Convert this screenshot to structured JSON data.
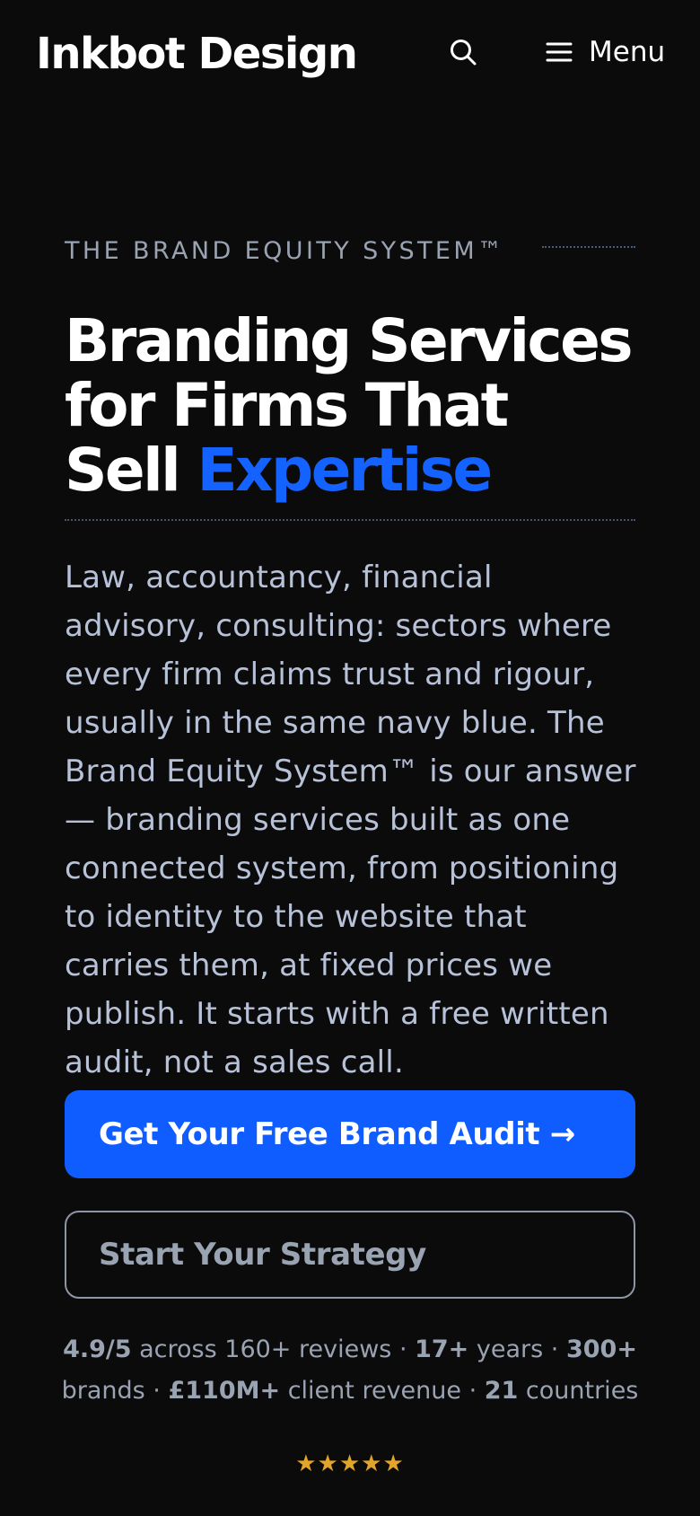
{
  "header": {
    "logo_text": "Inkbot Design",
    "search_icon": "search-icon",
    "menu_icon": "hamburger-icon",
    "menu_label": "Menu"
  },
  "hero": {
    "eyebrow": "THE BRAND EQUITY SYSTEM™",
    "headline_lines": [
      "Branding Services",
      "for Firms That",
      "Sell "
    ],
    "headline_accent": "Expertise",
    "intro": "Law, accountancy, financial advisory, consulting: sectors where every firm claims trust and rigour, usually in the same navy blue. The Brand Equity System™ is our answer — branding services built as one connected system, from positioning to identity to the website that carries them, at fixed prices we publish. It starts with a free written audit, not a sales call."
  },
  "cta": {
    "primary_label": "Get Your Free Brand Audit →",
    "secondary_label": "Start Your Strategy"
  },
  "proof": {
    "rating": "4.9/5",
    "reviews_text": " across 160+ reviews · ",
    "years_value": "17+",
    "years_text": " years · ",
    "brands_value": "300+",
    "brands_text": " brands · ",
    "revenue_value": "£110M+",
    "revenue_text": " client revenue · ",
    "countries_value": "21",
    "countries_text": " countries",
    "stars": "★★★★★",
    "star_rating": 5
  },
  "colors": {
    "background": "#0b0b0c",
    "accent": "#0f5cff",
    "star": "#e3a42a"
  }
}
